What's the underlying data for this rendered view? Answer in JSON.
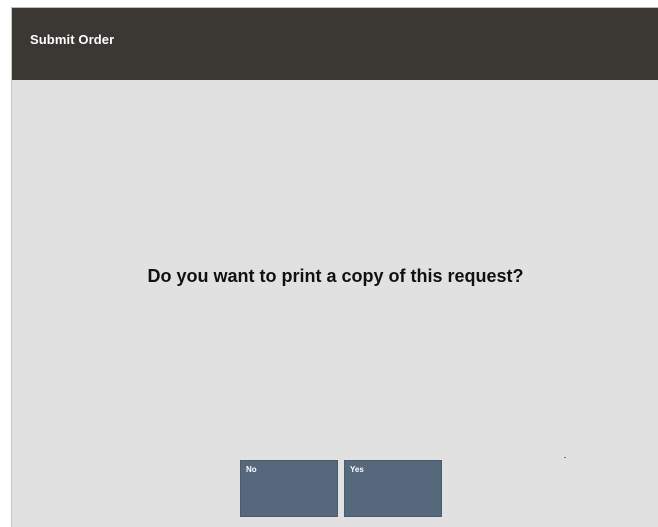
{
  "header": {
    "title": "Submit Order"
  },
  "dialog": {
    "prompt": "Do you want to print a copy of this request?"
  },
  "buttons": {
    "no_label": "No",
    "yes_label": "Yes"
  },
  "colors": {
    "header_bg": "#3b3834",
    "body_bg": "#e1e1e1",
    "button_bg": "#56687b"
  }
}
